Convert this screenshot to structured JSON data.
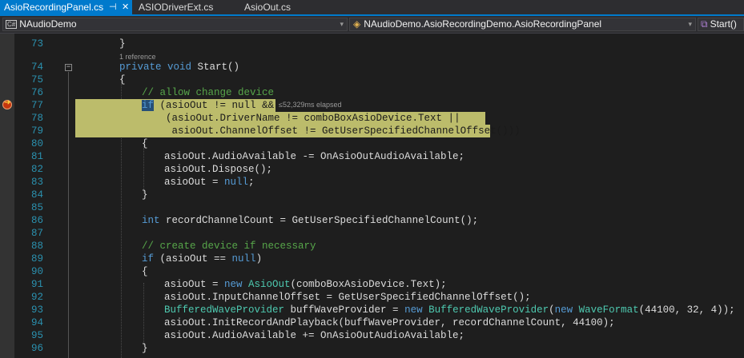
{
  "tabs": [
    {
      "label": "AsioRecordingPanel.cs",
      "active": true
    },
    {
      "label": "ASIODriverExt.cs",
      "active": false
    },
    {
      "label": "AsioOut.cs",
      "active": false
    }
  ],
  "tab_icons": {
    "pin": "pin-icon",
    "close": "close-icon"
  },
  "navbar": {
    "project": {
      "badge": "C#",
      "label": "NAudioDemo"
    },
    "type_scope": "NAudioDemo.AsioRecordingDemo.AsioRecordingPanel",
    "member": "Start()"
  },
  "editor": {
    "codelens": "1 reference",
    "perf_tip": "≤52,329ms elapsed",
    "line_numbers": [
      "73",
      "74",
      "75",
      "76",
      "77",
      "78",
      "79",
      "80",
      "81",
      "82",
      "83",
      "84",
      "85",
      "86",
      "87",
      "88",
      "89",
      "90",
      "91",
      "92",
      "93",
      "94",
      "95",
      "96"
    ],
    "lines": {
      "l73": "}",
      "l74": [
        "private ",
        "void",
        " Start()"
      ],
      "l75": "{",
      "l76": "// allow change device",
      "l77": [
        "if",
        " (asioOut != ",
        "null",
        " &&"
      ],
      "l78": "    (asioOut.DriverName != comboBoxAsioDevice.Text ||",
      "l79": "     asioOut.ChannelOffset != GetUserSpecifiedChannelOffset()))",
      "l80": "{",
      "l81": "asioOut.AudioAvailable -= OnAsioOutAudioAvailable;",
      "l82": "asioOut.Dispose();",
      "l83": [
        "asioOut = ",
        "null",
        ";"
      ],
      "l84": "}",
      "l85": "",
      "l86": [
        "int",
        " recordChannelCount = GetUserSpecifiedChannelCount();"
      ],
      "l87": "",
      "l88": "// create device if necessary",
      "l89": [
        "if",
        " (asioOut == ",
        "null",
        ")"
      ],
      "l90": "{",
      "l91": [
        "asioOut = ",
        "new ",
        "AsioOut",
        "(comboBoxAsioDevice.Text);"
      ],
      "l92": "asioOut.InputChannelOffset = GetUserSpecifiedChannelOffset();",
      "l93": [
        "BufferedWaveProvider",
        " buffWaveProvider = ",
        "new ",
        "BufferedWaveProvider",
        "(",
        "new ",
        "WaveFormat",
        "(44100, 32, 4));"
      ],
      "l94": "asioOut.InitRecordAndPlayback(buffWaveProvider, recordChannelCount, 44100);",
      "l95": "asioOut.AudioAvailable += OnAsioOutAudioAvailable;",
      "l96": "}"
    }
  },
  "colors": {
    "accent": "#007acc",
    "keyword": "#569cd6",
    "comment": "#57a64a",
    "type": "#4ec9b0",
    "line_number": "#2b91af",
    "current_statement_highlight": "#bcbc6b",
    "breakpoint": "#c4360f"
  }
}
